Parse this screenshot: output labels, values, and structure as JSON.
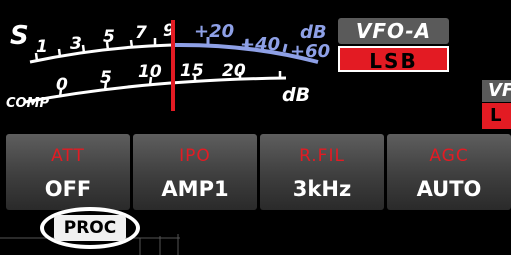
{
  "meter": {
    "s_label": "S",
    "s_scale": [
      "1",
      "3",
      "5",
      "7",
      "9",
      "+20",
      "+40",
      "+60"
    ],
    "db_label_top": "dB",
    "comp_label": "COMP",
    "comp_scale": [
      "0",
      "5",
      "10",
      "15",
      "20"
    ],
    "db_label_bottom": "dB",
    "colors": {
      "scale": "#ffffff",
      "over_scale": "#8ea0e6",
      "needle": "#e31b23"
    }
  },
  "vfo": {
    "label": "VFO-A",
    "mode": "LSB"
  },
  "vfo_b": {
    "label_partial": "VF",
    "mode_partial": "L"
  },
  "function_keys": [
    {
      "title": "ATT",
      "value": "OFF"
    },
    {
      "title": "IPO",
      "value": "AMP1"
    },
    {
      "title": "R.FIL",
      "value": "3kHz"
    },
    {
      "title": "AGC",
      "value": "AUTO"
    }
  ],
  "proc": {
    "label": "PROC"
  },
  "colors": {
    "accent_red": "#e31b23",
    "key_face": "#4a4a4a",
    "background": "#000000"
  }
}
